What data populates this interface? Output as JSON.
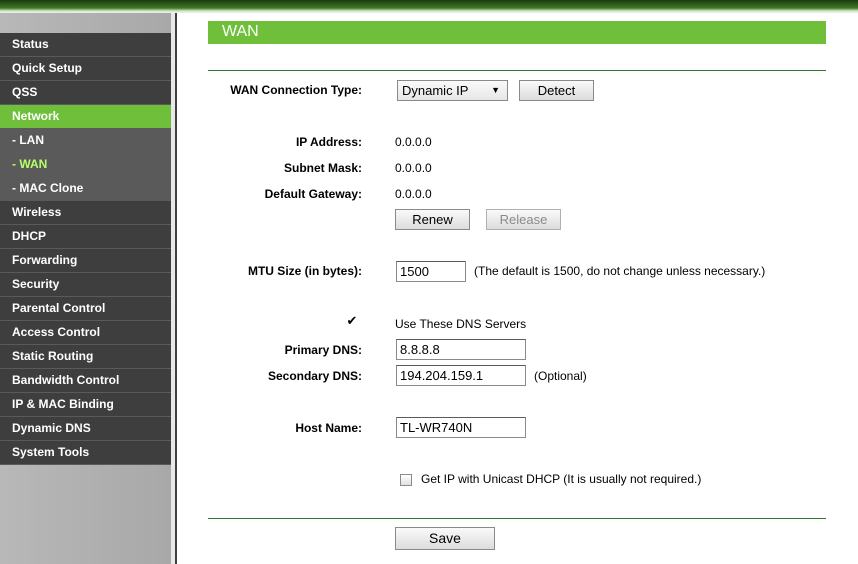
{
  "sidebar": {
    "items": [
      {
        "label": "Status"
      },
      {
        "label": "Quick Setup"
      },
      {
        "label": "QSS"
      },
      {
        "label": "Network"
      },
      {
        "label": "- LAN"
      },
      {
        "label": "- WAN"
      },
      {
        "label": "- MAC Clone"
      },
      {
        "label": "Wireless"
      },
      {
        "label": "DHCP"
      },
      {
        "label": "Forwarding"
      },
      {
        "label": "Security"
      },
      {
        "label": "Parental Control"
      },
      {
        "label": "Access Control"
      },
      {
        "label": "Static Routing"
      },
      {
        "label": "Bandwidth Control"
      },
      {
        "label": "IP & MAC Binding"
      },
      {
        "label": "Dynamic DNS"
      },
      {
        "label": "System Tools"
      }
    ]
  },
  "page": {
    "title": "WAN"
  },
  "wan": {
    "connection_type_label": "WAN Connection Type:",
    "connection_type_value": "Dynamic IP",
    "detect_label": "Detect",
    "ip_address_label": "IP Address:",
    "ip_address_value": "0.0.0.0",
    "subnet_mask_label": "Subnet Mask:",
    "subnet_mask_value": "0.0.0.0",
    "gateway_label": "Default Gateway:",
    "gateway_value": "0.0.0.0",
    "renew_label": "Renew",
    "release_label": "Release",
    "mtu_label": "MTU Size (in bytes):",
    "mtu_value": "1500",
    "mtu_hint": "(The default is 1500, do not change unless necessary.)",
    "dns_check_mark": "✔",
    "use_dns_label": "Use These DNS Servers",
    "primary_dns_label": "Primary DNS:",
    "primary_dns_value": "8.8.8.8",
    "secondary_dns_label": "Secondary DNS:",
    "secondary_dns_value": "194.204.159.1",
    "optional_hint": "(Optional)",
    "host_name_label": "Host Name:",
    "host_name_value": "TL-WR740N",
    "unicast_label": "Get IP with Unicast DHCP (It is usually not required.)",
    "save_label": "Save"
  },
  "colors": {
    "accent_green": "#6fbf3a",
    "menu_dark": "#3e3e3e",
    "current_sub": "#b8ff6a"
  }
}
